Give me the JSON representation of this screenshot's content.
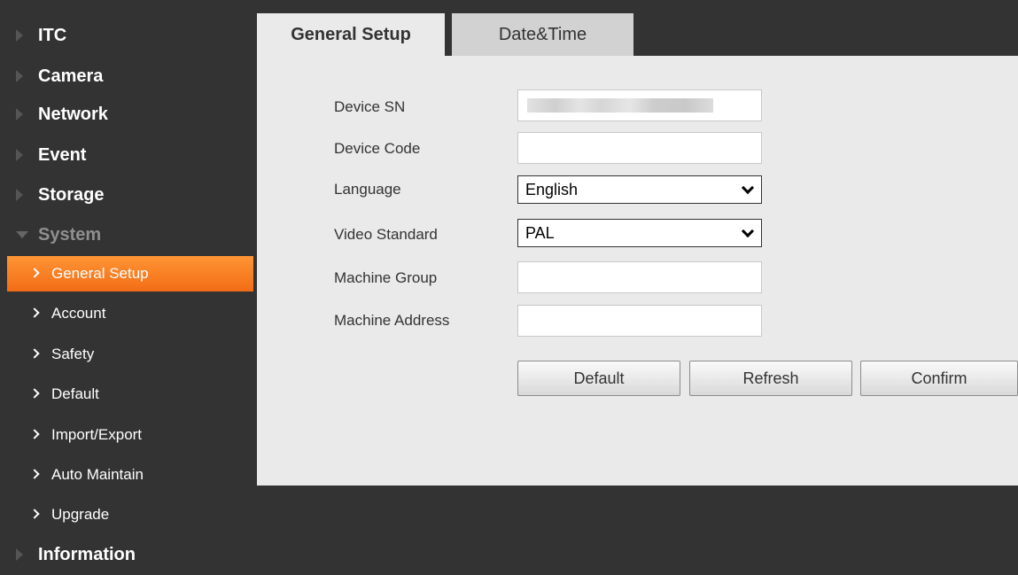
{
  "sidebar": {
    "menu": [
      {
        "label": "ITC"
      },
      {
        "label": "Camera"
      },
      {
        "label": "Network"
      },
      {
        "label": "Event"
      },
      {
        "label": "Storage"
      },
      {
        "label": "System"
      },
      {
        "label": "Information"
      }
    ],
    "system_items": [
      {
        "label": "General Setup"
      },
      {
        "label": "Account"
      },
      {
        "label": "Safety"
      },
      {
        "label": "Default"
      },
      {
        "label": "Import/Export"
      },
      {
        "label": "Auto Maintain"
      },
      {
        "label": "Upgrade"
      }
    ],
    "active_item": "General Setup",
    "active_color": "#f57b20"
  },
  "tabs": [
    {
      "label": "General Setup",
      "active": true
    },
    {
      "label": "Date&Time",
      "active": false
    }
  ],
  "form": {
    "device_sn": {
      "label": "Device SN",
      "value": ""
    },
    "device_code": {
      "label": "Device Code",
      "value": ""
    },
    "language": {
      "label": "Language",
      "value": "English"
    },
    "video_standard": {
      "label": "Video Standard",
      "value": "PAL"
    },
    "machine_group": {
      "label": "Machine Group",
      "value": ""
    },
    "machine_address": {
      "label": "Machine Address",
      "value": ""
    }
  },
  "buttons": {
    "default": "Default",
    "refresh": "Refresh",
    "confirm": "Confirm"
  }
}
